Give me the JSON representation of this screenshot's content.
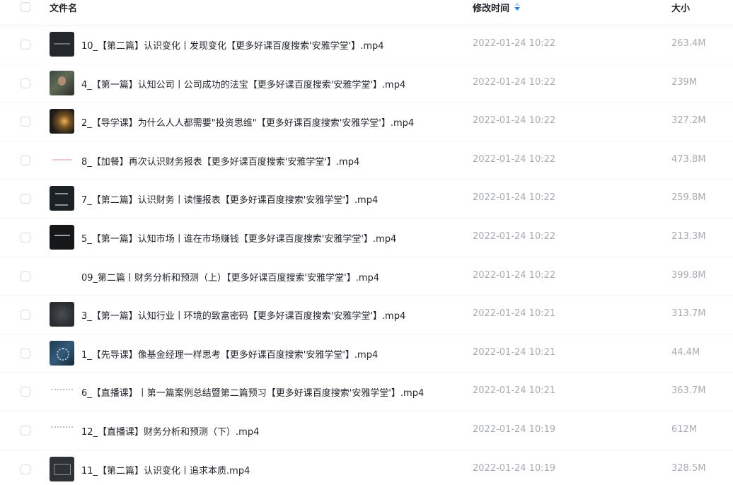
{
  "header": {
    "name_label": "文件名",
    "time_label": "修改时间",
    "size_label": "大小"
  },
  "rows": [
    {
      "name": "10_【第二篇】认识变化丨发现变化【更多好课百度搜索'安雅学堂'】.mp4",
      "time": "2022-01-24 10:22",
      "size": "263.4M"
    },
    {
      "name": "4_【第一篇】认知公司丨公司成功的法宝【更多好课百度搜索'安雅学堂'】.mp4",
      "time": "2022-01-24 10:22",
      "size": "239M"
    },
    {
      "name": "2_【导学课】为什么人人都需要\"投资思维\"【更多好课百度搜索'安雅学堂'】.mp4",
      "time": "2022-01-24 10:22",
      "size": "327.2M"
    },
    {
      "name": "8_【加餐】再次认识财务报表【更多好课百度搜索'安雅学堂'】.mp4",
      "time": "2022-01-24 10:22",
      "size": "473.8M"
    },
    {
      "name": "7_【第二篇】认识财务丨读懂报表【更多好课百度搜索'安雅学堂'】.mp4",
      "time": "2022-01-24 10:22",
      "size": "259.8M"
    },
    {
      "name": "5_【第一篇】认知市场丨谁在市场赚钱【更多好课百度搜索'安雅学堂'】.mp4",
      "time": "2022-01-24 10:22",
      "size": "213.3M"
    },
    {
      "name": "09_第二篇丨财务分析和预测（上）【更多好课百度搜索'安雅学堂'】.mp4",
      "time": "2022-01-24 10:22",
      "size": "399.8M"
    },
    {
      "name": "3_【第一篇】认知行业丨环境的致富密码【更多好课百度搜索'安雅学堂'】.mp4",
      "time": "2022-01-24 10:21",
      "size": "313.7M"
    },
    {
      "name": "1_【先导课】像基金经理一样思考【更多好课百度搜索'安雅学堂'】.mp4",
      "time": "2022-01-24 10:21",
      "size": "44.4M"
    },
    {
      "name": "6_【直播课】丨第一篇案例总结暨第二篇预习【更多好课百度搜索'安雅学堂'】.mp4",
      "time": "2022-01-24 10:21",
      "size": "363.7M"
    },
    {
      "name": "12_【直播课】财务分析和预测（下）.mp4",
      "time": "2022-01-24 10:19",
      "size": "612M"
    },
    {
      "name": "11_【第二篇】认识变化丨追求本质.mp4",
      "time": "2022-01-24 10:19",
      "size": "328.5M"
    }
  ],
  "colors": {
    "text_primary": "#1f2329",
    "text_secondary": "#a8acb3",
    "sort_active": "#2c7cf6",
    "divider": "#f2f3f5"
  }
}
